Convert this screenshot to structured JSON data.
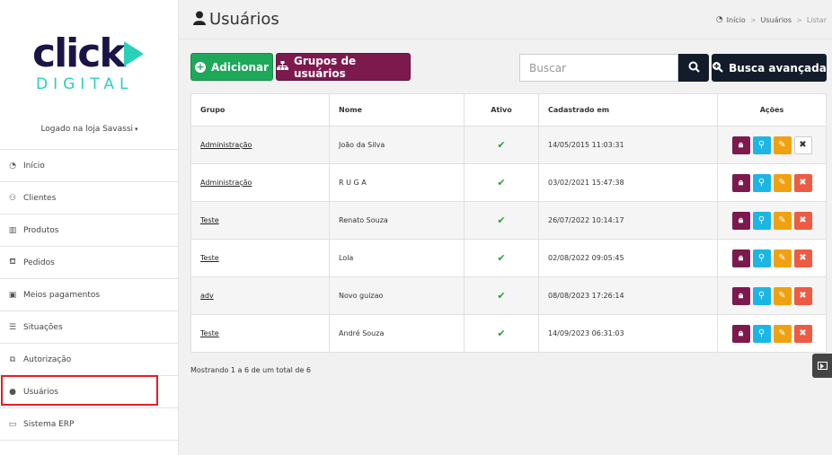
{
  "brand": {
    "top": "click",
    "bottom": "DIGITAL",
    "primary_color": "#1b1547",
    "accent_color": "#2ad1b8"
  },
  "sidebar": {
    "store_label": "Logado na loja Savassi",
    "items": [
      {
        "label": "Início",
        "icon": "dashboard-icon"
      },
      {
        "label": "Clientes",
        "icon": "users-icon"
      },
      {
        "label": "Produtos",
        "icon": "barcode-icon"
      },
      {
        "label": "Pedidos",
        "icon": "basket-icon"
      },
      {
        "label": "Meios pagamentos",
        "icon": "money-icon"
      },
      {
        "label": "Situações",
        "icon": "list-icon"
      },
      {
        "label": "Autorização",
        "icon": "sitemap-icon"
      },
      {
        "label": "Usuários",
        "icon": "user-icon"
      },
      {
        "label": "Sistema ERP",
        "icon": "laptop-icon"
      }
    ]
  },
  "header": {
    "title": "Usuários",
    "breadcrumb": [
      "Início",
      "Usuários",
      "Listar"
    ]
  },
  "toolbar": {
    "add_label": "Adicionar",
    "groups_label": "Grupos de usuários",
    "search_placeholder": "Buscar",
    "advanced_label": "Busca avançada"
  },
  "table": {
    "headers": {
      "grupo": "Grupo",
      "nome": "Nome",
      "ativo": "Ativo",
      "cadastrado": "Cadastrado em",
      "acoes": "Ações"
    },
    "rows": [
      {
        "grupo": "Administração",
        "nome": "João da Silva",
        "ativo": "✔",
        "cadastrado": "14/05/2015 11:03:31"
      },
      {
        "grupo": "Administração",
        "nome": "R U G A",
        "ativo": "✔",
        "cadastrado": "03/02/2021 15:47:38"
      },
      {
        "grupo": "Teste",
        "nome": "Renato Souza",
        "ativo": "✔",
        "cadastrado": "26/07/2022 10:14:17"
      },
      {
        "grupo": "Teste",
        "nome": "Lola",
        "ativo": "✔",
        "cadastrado": "02/08/2022 09:05:45"
      },
      {
        "grupo": "adv",
        "nome": "Novo guizao",
        "ativo": "✔",
        "cadastrado": "08/08/2023 17:26:14"
      },
      {
        "grupo": "Teste",
        "nome": "André Souza",
        "ativo": "✔",
        "cadastrado": "14/09/2023 06:31:03"
      }
    ]
  },
  "footer": {
    "info": "Mostrando 1 a 6 de um total de 6"
  }
}
